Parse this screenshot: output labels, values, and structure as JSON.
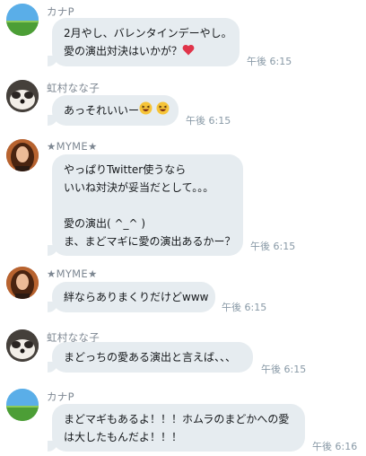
{
  "messages": [
    {
      "user": "カナP",
      "avatar": "grass-field-avatar",
      "lines": [
        "2月やし、バレンタインデーやし。",
        "愛の演出対決はいかが？"
      ],
      "emoji": "heart",
      "time": "午後 6:15"
    },
    {
      "user": "虹村なな子",
      "avatar": "dog-avatar",
      "lines": [
        "あっそれいいー"
      ],
      "emoji": "laughing-face-x2",
      "time": "午後 6:15"
    },
    {
      "user": "★MYME★",
      "avatar": "girl-avatar",
      "lines": [
        "やっぱりTwitter使うなら",
        "いいね対決が妥当だとして。。。",
        "",
        "愛の演出( ^_^ )",
        "ま、まどマギに愛の演出あるかー？"
      ],
      "time": "午後 6:15"
    },
    {
      "user": "★MYME★",
      "avatar": "girl-avatar",
      "lines": [
        "絆ならありまくりだけどwww"
      ],
      "time": "午後 6:15"
    },
    {
      "user": "虹村なな子",
      "avatar": "dog-avatar",
      "lines": [
        "まどっちの愛ある演出と言えば、、、"
      ],
      "time": "午後 6:15"
    },
    {
      "user": "カナP",
      "avatar": "grass-field-avatar",
      "lines": [
        "まどマギもあるよ！！！ホムラのまどかへの愛",
        "は大したもんだよ！！！"
      ],
      "time": "午後 6:16"
    }
  ]
}
